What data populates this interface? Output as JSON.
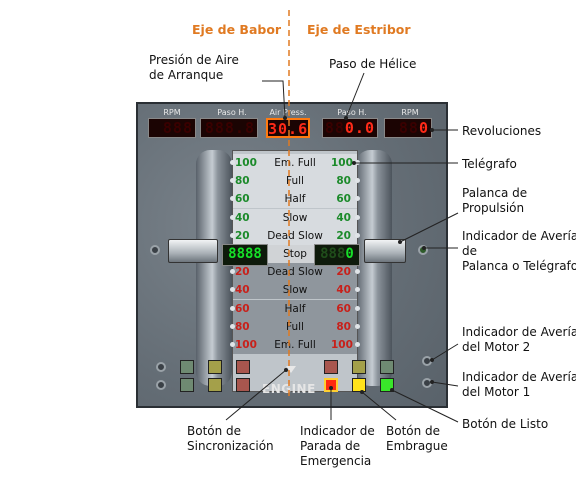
{
  "axes": {
    "babor": "Eje de Babor",
    "estribor": "Eje de Estribor"
  },
  "panel": {
    "headers": [
      "RPM",
      "Paso H.",
      "Air Press.",
      "Paso H.",
      "RPM"
    ],
    "lcd_port_rpm": {
      "dim": "888",
      "lit": ""
    },
    "lcd_port_pitch": {
      "dim": "888.8",
      "lit": ""
    },
    "lcd_air": "30.6",
    "lcd_stbd_pitch": {
      "dim": "88",
      "lit": "0.0"
    },
    "lcd_stbd_rpm": {
      "dim": "88",
      "lit": "0"
    },
    "telegraph_rows": [
      {
        "l": "100",
        "m": "Em. Full",
        "r": "100",
        "type": "ahead"
      },
      {
        "l": "80",
        "m": "Full",
        "r": "80",
        "type": "ahead"
      },
      {
        "l": "60",
        "m": "Half",
        "r": "60",
        "type": "ahead"
      },
      {
        "l": "40",
        "m": "Slow",
        "r": "40",
        "type": "ahead"
      },
      {
        "l": "20",
        "m": "Dead Slow",
        "r": "20",
        "type": "ahead"
      },
      {
        "l": "",
        "m": "Stop",
        "r": "",
        "type": "stop"
      },
      {
        "l": "20",
        "m": "Dead Slow",
        "r": "20",
        "type": "astern"
      },
      {
        "l": "40",
        "m": "Slow",
        "r": "40",
        "type": "astern"
      },
      {
        "l": "60",
        "m": "Half",
        "r": "60",
        "type": "astern"
      },
      {
        "l": "80",
        "m": "Full",
        "r": "80",
        "type": "astern"
      },
      {
        "l": "100",
        "m": "Em. Full",
        "r": "100",
        "type": "astern"
      }
    ],
    "green_lcd_left": "8888",
    "green_lcd_right": {
      "dim": "888",
      "lit": "0"
    },
    "engine_label": "ENGINE",
    "colors": {
      "accent": "#e07a22",
      "lcd_red": "#ff2a18",
      "lcd_green": "#16e028"
    }
  },
  "labels": {
    "presion_aire": "Presión de Aire\nde Arranque",
    "paso_helice": "Paso de Hélice",
    "revoluciones": "Revoluciones",
    "telegrafo": "Telégrafo",
    "palanca": "Palanca de\nPropulsión",
    "averia_palanca": "Indicador de Avería\nde\nPalanca o Telégrafo",
    "averia_m2": "Indicador de Avería\ndel Motor 2",
    "averia_m1": "Indicador de Avería\ndel Motor 1",
    "boton_listo": "Botón  de Listo",
    "boton_sinc": "Botón de\nSincronización",
    "parada_emerg": "Indicador de\nParada de\nEmergencia",
    "boton_embrague": "Botón de\nEmbrague"
  }
}
